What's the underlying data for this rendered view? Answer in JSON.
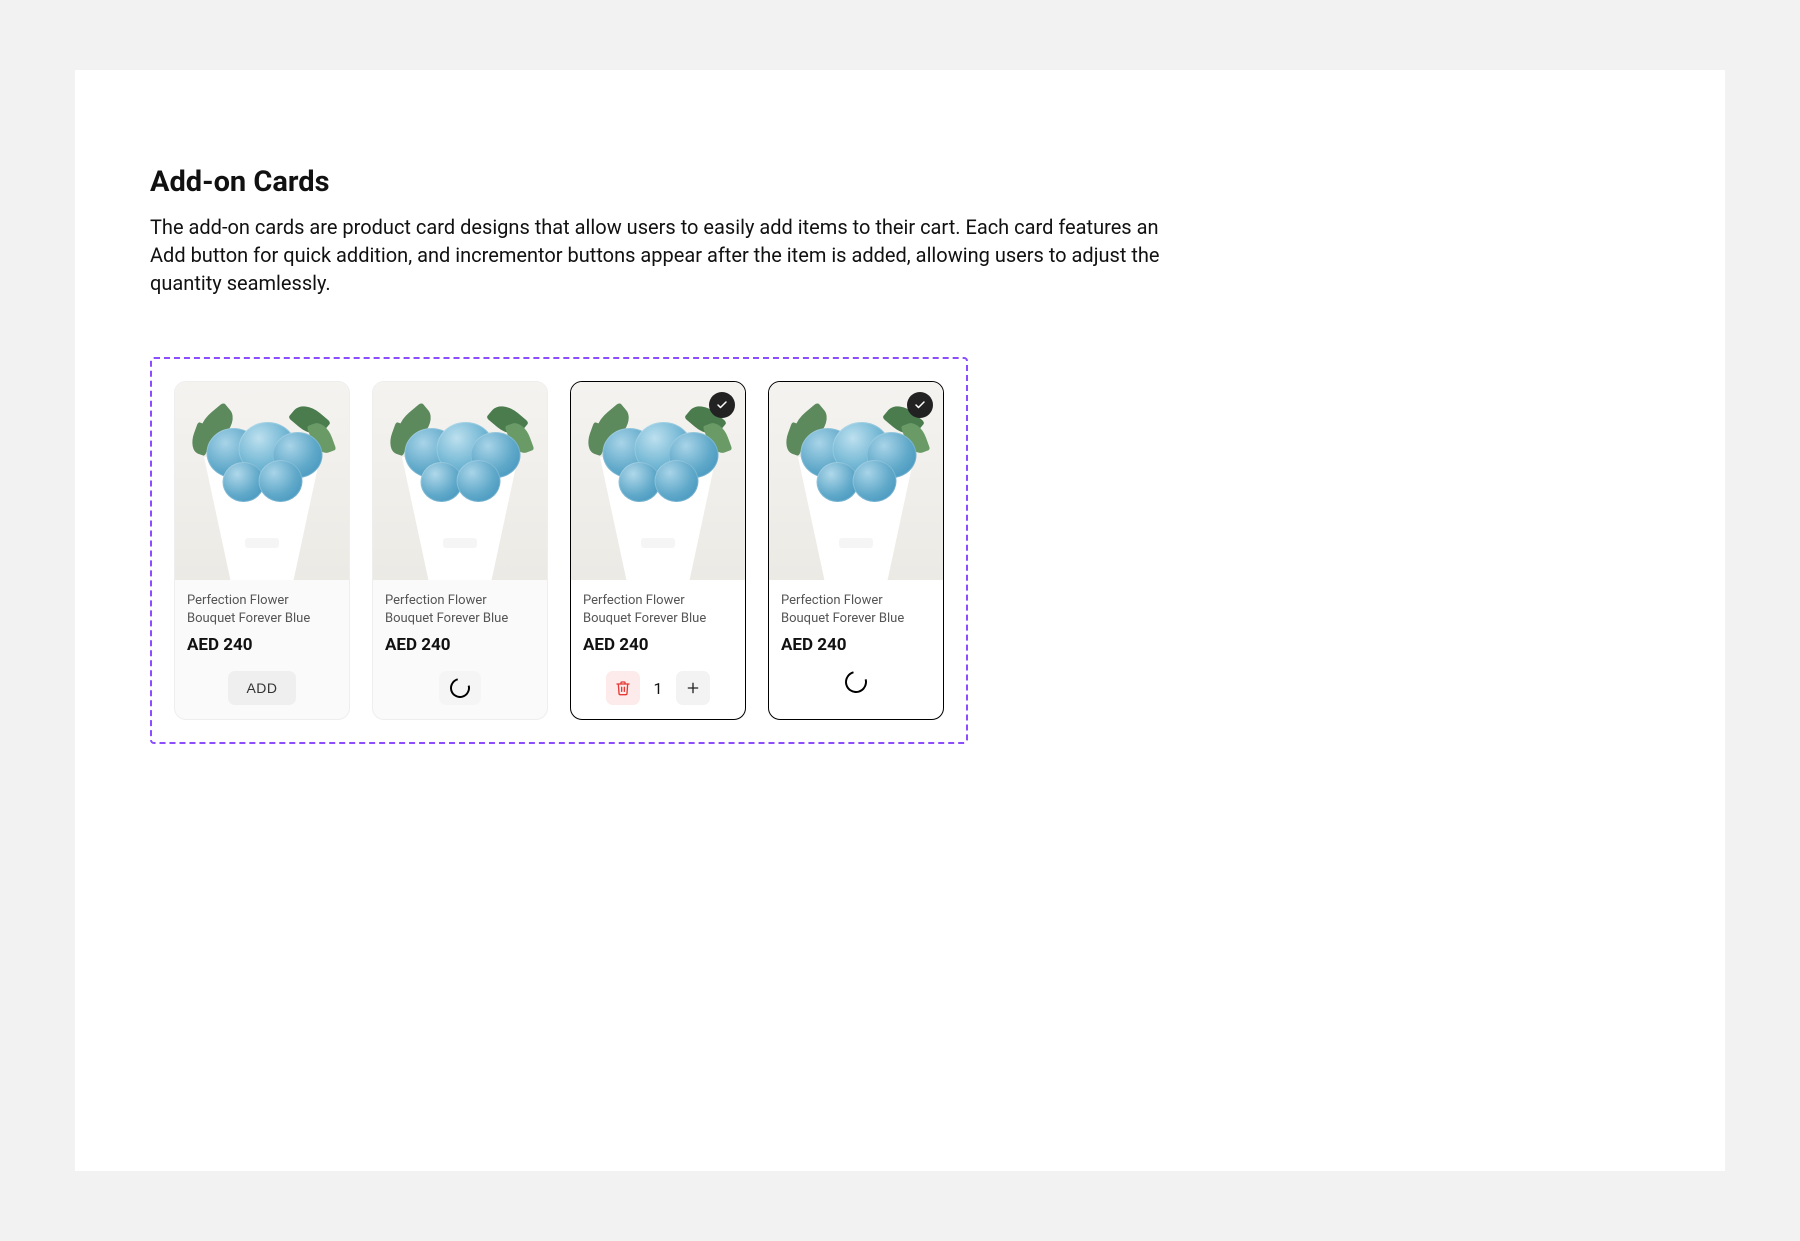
{
  "section": {
    "heading": "Add-on Cards",
    "description": "The add-on cards are product card designs that allow users to easily add items to their cart. Each card features an Add button for quick addition, and incrementor buttons appear after the item is added, allowing users to adjust the quantity seamlessly."
  },
  "cards": [
    {
      "name": "Perfection Flower Bouquet Forever Blue",
      "price": "AED 240",
      "state": "default",
      "add_label": "ADD"
    },
    {
      "name": "Perfection Flower Bouquet Forever Blue",
      "price": "AED 240",
      "state": "loading"
    },
    {
      "name": "Perfection Flower Bouquet Forever Blue",
      "price": "AED 240",
      "state": "selected-qty",
      "quantity": "1"
    },
    {
      "name": "Perfection Flower Bouquet Forever Blue",
      "price": "AED 240",
      "state": "selected-loading"
    }
  ]
}
